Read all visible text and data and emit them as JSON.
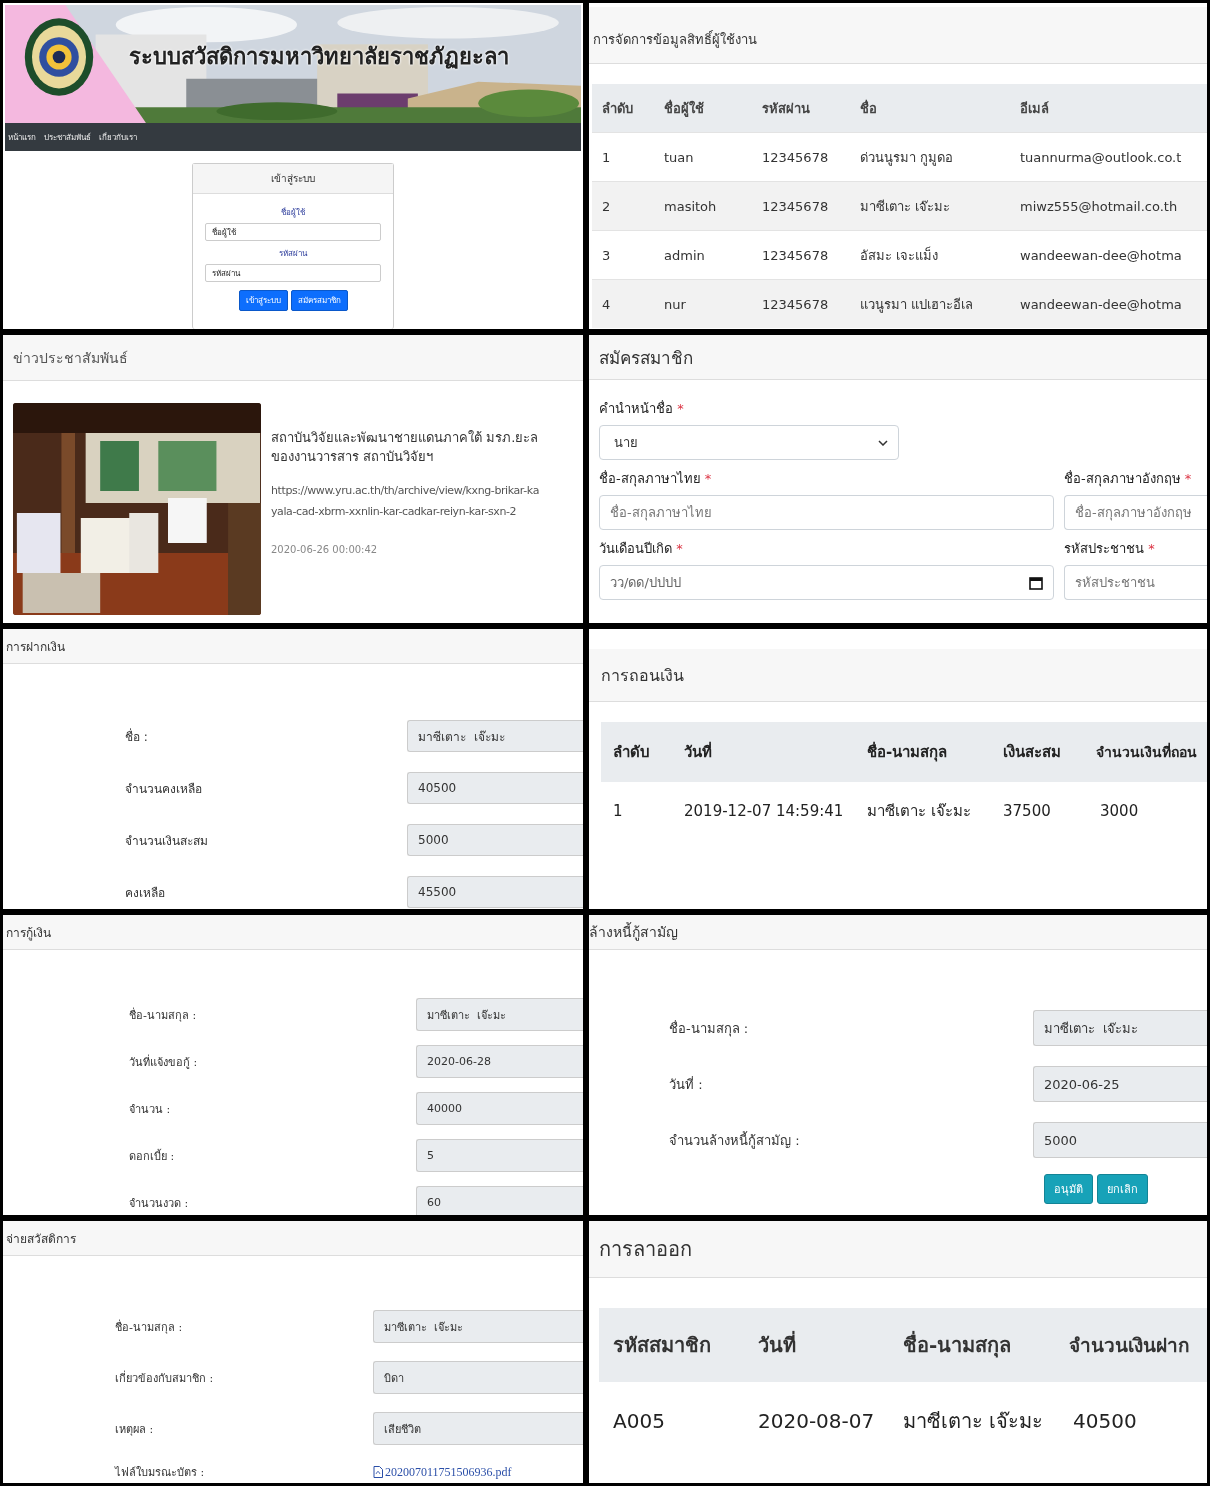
{
  "login_page": {
    "banner_title": "ระบบสวัสดิการมหาวิทยาลัยราชภัฏยะลา",
    "nav": [
      "หน้าแรก",
      "ประชาสัมพันธ์",
      "เกี่ยวกับเรา"
    ],
    "login_card": {
      "title": "เข้าสู่ระบบ",
      "fields": [
        {
          "label": "ชื่อผู้ใช้",
          "placeholder": "ชื่อผู้ใช้"
        },
        {
          "label": "รหัสผ่าน",
          "placeholder": "รหัสผ่าน"
        }
      ],
      "buttons": [
        "เข้าสู่ระบบ",
        "สมัครสมาชิก"
      ]
    }
  },
  "user_management": {
    "title": "การจัดการข้อมูลสิทธิ์ผู้ใช้งาน",
    "columns": [
      "ลำดับ",
      "ชื่อผู้ใช้",
      "รหัสผ่าน",
      "ชื่อ",
      "อีเมล์"
    ],
    "rows": [
      [
        "1",
        "tuan",
        "12345678",
        "ด่วนนูรมา กูมูดอ",
        "tuannurma@outlook.co.t"
      ],
      [
        "2",
        "masitoh",
        "12345678",
        "มาซีเตาะ เจ๊ะมะ",
        "miwz555@hotmail.co.th"
      ],
      [
        "3",
        "admin",
        "12345678",
        "อัสมะ เจะแม็ง",
        "wandeewan-dee@hotma"
      ],
      [
        "4",
        "nur",
        "12345678",
        "แวนูรมา แปเฮาะอีเล",
        "wandeewan-dee@hotma"
      ]
    ]
  },
  "news": {
    "title": "ข่าวประชาสัมพันธ์",
    "item": {
      "headline_lines": [
        "สถาบันวิจัยและพัฒนาชายแดนภาคใต้ มรภ.ยะล",
        "ของงานวารสาร สถาบันวิจัยฯ"
      ],
      "url_lines": [
        "https://www.yru.ac.th/th/archive/view/kxng-brikar-ka",
        "yala-cad-xbrm-xxnlin-kar-cadkar-reiyn-kar-sxn-2"
      ],
      "timestamp": "2020-06-26 00:00:42"
    }
  },
  "register": {
    "title": "สมัครสมาชิก",
    "rows": [
      [
        {
          "label": "คำนำหน้าชื่อ",
          "required_mark": "*",
          "kind": "select",
          "value": "นาย"
        }
      ],
      [
        {
          "label": "ชื่อ-สกุลภาษาไทย",
          "required_mark": "*",
          "kind": "text",
          "placeholder": "ชื่อ-สกุลภาษาไทย"
        },
        {
          "label": "ชื่อ-สกุลภาษาอังกฤษ",
          "required_mark": "*",
          "kind": "text",
          "placeholder": "ชื่อ-สกุลภาษาอังกฤษ"
        }
      ],
      [
        {
          "label": "วันเดือนปีเกิด",
          "required_mark": "*",
          "kind": "date",
          "placeholder": "วว/ดด/ปปปป"
        },
        {
          "label": "รหัสประชาชน",
          "required_mark": "*",
          "kind": "text",
          "placeholder": "รหัสประชาชน"
        }
      ]
    ]
  },
  "deposit": {
    "title": "การฝากเงิน",
    "fields": [
      {
        "label": "ชื่อ :",
        "value": "มาซีเตาะ  เจ๊ะมะ"
      },
      {
        "label": "จำนวนคงเหลือ",
        "value": "40500"
      },
      {
        "label": "จำนวนเงินสะสม",
        "value": "5000"
      },
      {
        "label": "คงเหลือ",
        "value": "45500"
      }
    ]
  },
  "withdrawal": {
    "title": "การถอนเงิน",
    "columns": [
      "ลำดับ",
      "วันที่",
      "ชื่อ-นามสกุล",
      "เงินสะสม",
      "จำนวนเงินที่ถอน"
    ],
    "rows": [
      [
        "1",
        "2019-12-07 14:59:41",
        "มาซีเตาะ เจ๊ะมะ",
        "37500",
        "3000"
      ]
    ]
  },
  "loan": {
    "title": "การกู้เงิน",
    "fields": [
      {
        "label": "ชื่อ-นามสกุล :",
        "value": "มาซีเตาะ  เจ๊ะมะ"
      },
      {
        "label": "วันที่แจ้งขอกู้ :",
        "value": "2020-06-28"
      },
      {
        "label": "จำนวน :",
        "value": "40000"
      },
      {
        "label": "ดอกเบี้ย :",
        "value": "5"
      },
      {
        "label": "จำนวนงวด :",
        "value": "60"
      }
    ]
  },
  "debt_clearing": {
    "title": "ล้างหนี้กู้สามัญ",
    "fields": [
      {
        "label": "ชื่อ-นามสกุล :",
        "value": "มาซีเตาะ  เจ๊ะมะ"
      },
      {
        "label": "วันที่ :",
        "value": "2020-06-25"
      },
      {
        "label": "จำนวนล้างหนี้กู้สามัญ :",
        "value": "5000"
      }
    ],
    "buttons": [
      "อนุมัติ",
      "ยกเลิก"
    ]
  },
  "welfare_payment": {
    "title": "จ่ายสวัสดิการ",
    "fields": [
      {
        "label": "ชื่อ-นามสกุล :",
        "value": "มาซีเตาะ  เจ๊ะมะ"
      },
      {
        "label": "เกี่ยวข้องกับสมาชิก :",
        "value": "บิดา"
      },
      {
        "label": "เหตุผล :",
        "value": "เสียชีวิต"
      }
    ],
    "file": {
      "label": "ไฟล์ใบมรณะบัตร :",
      "link": "202007011751506936.pdf"
    }
  },
  "leave": {
    "title": "การลาออก",
    "columns": [
      "รหัสสมาชิก",
      "วันที่",
      "ชื่อ-นามสกุล",
      "จำนวนเงินฝาก"
    ],
    "rows": [
      [
        "A005",
        "2020-08-07",
        "มาซีเตาะ เจ๊ะมะ",
        "40500"
      ]
    ]
  }
}
